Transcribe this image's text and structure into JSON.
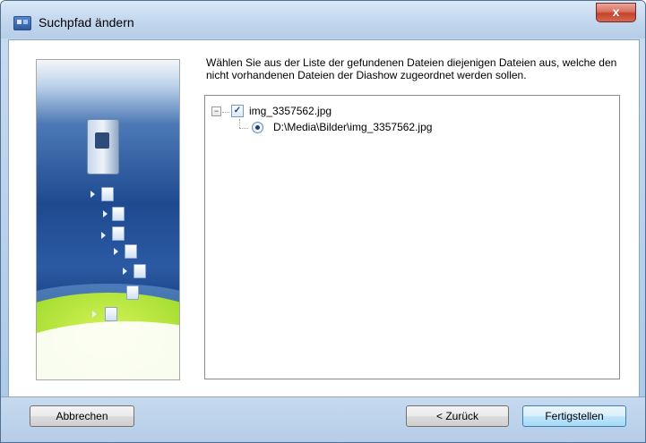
{
  "window": {
    "title": "Suchpfad ändern",
    "close_label": "x"
  },
  "instruction": "Wählen Sie aus der Liste der gefundenen Dateien diejenigen Dateien aus, welche den nicht vorhandenen Dateien der Diashow zugeordnet werden sollen.",
  "tree": {
    "items": [
      {
        "label": "img_3357562.jpg",
        "checked": true,
        "expanded": true,
        "children": [
          {
            "label": "D:\\Media\\Bilder\\img_3357562.jpg",
            "selected": true
          }
        ]
      }
    ]
  },
  "buttons": {
    "cancel": "Abbrechen",
    "back": "< Zurück",
    "finish": "Fertigstellen"
  },
  "icons": {
    "app": "app-window-icon",
    "expander": "tree-collapse-icon",
    "checkbox": "checkbox-checked-icon",
    "radio": "radio-selected-icon"
  },
  "colors": {
    "title_bar": "#c4d8ee",
    "close_button": "#c3412d",
    "primary_button_border": "#3c7fb1",
    "banner_blue": "#1f4a90",
    "banner_green": "#a8df33"
  }
}
